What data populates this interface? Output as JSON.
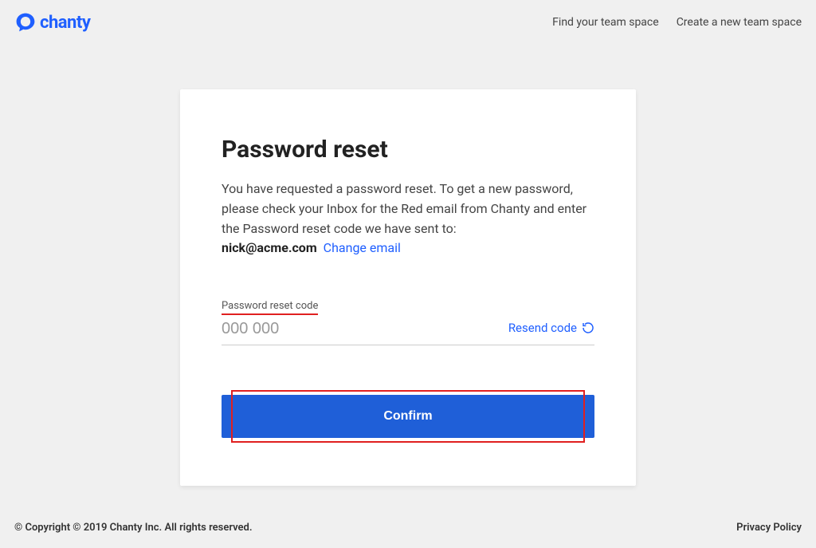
{
  "brand": {
    "name": "chanty"
  },
  "nav": {
    "find_team": "Find your team space",
    "create_team": "Create a new team space"
  },
  "card": {
    "title": "Password reset",
    "description": "You have requested a password reset. To get a new password, please check your Inbox for the Red email from Chanty and enter the Password reset code we have sent to:",
    "email": "nick@acme.com",
    "change_email": "Change email",
    "field_label": "Password reset code",
    "field_placeholder": "000 000",
    "resend_label": "Resend code",
    "confirm_label": "Confirm"
  },
  "footer": {
    "copyright": "© Copyright © 2019 Chanty Inc. All rights reserved.",
    "privacy": "Privacy Policy"
  }
}
